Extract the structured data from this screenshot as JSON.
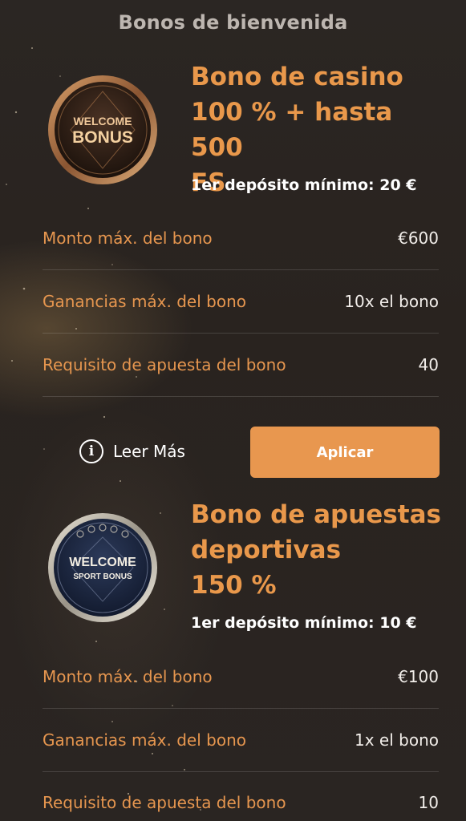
{
  "header": {
    "title": "Bonos de bienvenida"
  },
  "colors": {
    "accent": "#e8974f",
    "background": "#2a2522",
    "text": "#ffffff"
  },
  "bonuses": [
    {
      "badge": {
        "line1": "WELCOME",
        "line2": "BONUS",
        "icon": "welcome-bonus-badge"
      },
      "title_lines": [
        "Bono de casino",
        "100 % + hasta 500",
        "FS"
      ],
      "min_deposit": "1er depósito mínimo: 20 €",
      "rows": [
        {
          "label": "Monto máx. del bono",
          "value": "€600"
        },
        {
          "label": "Ganancias máx. del bono",
          "value": "10x el bono"
        },
        {
          "label": "Requisito de apuesta del bono",
          "value": "40"
        }
      ],
      "read_more": "Leer Más",
      "apply": "Aplicar"
    },
    {
      "badge": {
        "line1": "WELCOME",
        "line2": "SPORT BONUS",
        "icon": "welcome-sport-bonus-badge"
      },
      "title_lines": [
        "Bono de apuestas",
        "deportivas",
        "150 %"
      ],
      "min_deposit": "1er depósito mínimo: 10 €",
      "rows": [
        {
          "label": "Monto máx. del bono",
          "value": "€100"
        },
        {
          "label": "Ganancias máx. del bono",
          "value": "1x el bono"
        },
        {
          "label": "Requisito de apuesta del bono",
          "value": "10"
        }
      ]
    }
  ]
}
